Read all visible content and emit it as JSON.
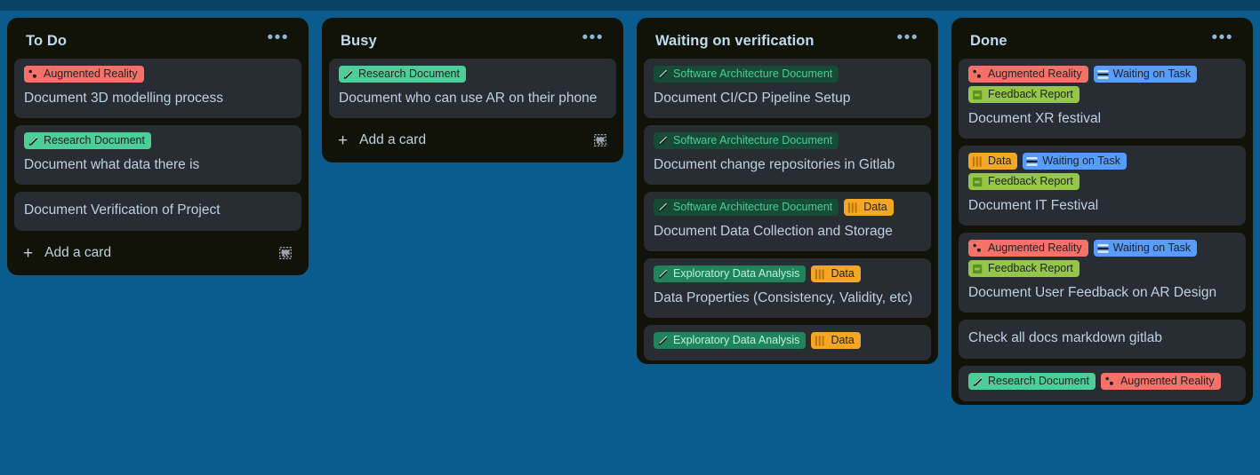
{
  "board": {
    "background_color": "#0a5c8f",
    "top_band_color": "#084264",
    "list_background": "#111208",
    "card_background": "#282c33"
  },
  "label_styles": {
    "augmented_reality": {
      "bg": "#f87168",
      "fg": "#1d2125",
      "icon": "particles-icon"
    },
    "research_document": {
      "bg": "#4bce97",
      "fg": "#1d2125",
      "icon": "pencil-icon"
    },
    "software_architecture_document": {
      "bg": "#164b35",
      "fg": "#4bce97",
      "icon": "pencil-icon"
    },
    "exploratory_data_analysis": {
      "bg": "#1f845a",
      "fg": "#baf3db",
      "icon": "pencil-icon"
    },
    "data": {
      "bg": "#f5a623",
      "fg": "#1d2125",
      "icon": "bars-icon"
    },
    "waiting_on_task": {
      "bg": "#579dff",
      "fg": "#1d2125",
      "icon": "stacked-lines-icon"
    },
    "feedback_report": {
      "bg": "#94c748",
      "fg": "#1d2125",
      "icon": "speech-bubble-icon"
    }
  },
  "add_card_label": "Add a card",
  "list_menu_glyph": "•••",
  "lists": [
    {
      "title": "To Do",
      "cards": [
        {
          "labels": [
            {
              "text": "Augmented Reality",
              "style": "augmented_reality"
            }
          ],
          "title": "Document 3D modelling process"
        },
        {
          "labels": [
            {
              "text": "Research Document",
              "style": "research_document"
            }
          ],
          "title": "Document what data there is"
        },
        {
          "labels": [],
          "title": "Document Verification of Project"
        }
      ],
      "show_add_card": true
    },
    {
      "title": "Busy",
      "cards": [
        {
          "labels": [
            {
              "text": "Research Document",
              "style": "research_document"
            }
          ],
          "title": "Document who can use AR on their phone"
        }
      ],
      "show_add_card": true
    },
    {
      "title": "Waiting on verification",
      "cards": [
        {
          "labels": [
            {
              "text": "Software Architecture Document",
              "style": "software_architecture_document"
            }
          ],
          "title": "Document CI/CD Pipeline Setup"
        },
        {
          "labels": [
            {
              "text": "Software Architecture Document",
              "style": "software_architecture_document"
            }
          ],
          "title": "Document change repositories in Gitlab"
        },
        {
          "labels": [
            {
              "text": "Software Architecture Document",
              "style": "software_architecture_document"
            },
            {
              "text": "Data",
              "style": "data"
            }
          ],
          "title": "Document Data Collection and Storage"
        },
        {
          "labels": [
            {
              "text": "Exploratory Data Analysis",
              "style": "exploratory_data_analysis"
            },
            {
              "text": "Data",
              "style": "data"
            }
          ],
          "title": "Data Properties (Consistency, Validity, etc)"
        },
        {
          "labels": [
            {
              "text": "Exploratory Data Analysis",
              "style": "exploratory_data_analysis"
            },
            {
              "text": "Data",
              "style": "data"
            }
          ],
          "title": ""
        }
      ],
      "show_add_card": false
    },
    {
      "title": "Done",
      "cards": [
        {
          "labels": [
            {
              "text": "Augmented Reality",
              "style": "augmented_reality"
            },
            {
              "text": "Waiting on Task",
              "style": "waiting_on_task"
            },
            {
              "text": "Feedback Report",
              "style": "feedback_report"
            }
          ],
          "title": "Document XR festival"
        },
        {
          "labels": [
            {
              "text": "Data",
              "style": "data"
            },
            {
              "text": "Waiting on Task",
              "style": "waiting_on_task"
            },
            {
              "text": "Feedback Report",
              "style": "feedback_report"
            }
          ],
          "title": "Document IT Festival"
        },
        {
          "labels": [
            {
              "text": "Augmented Reality",
              "style": "augmented_reality"
            },
            {
              "text": "Waiting on Task",
              "style": "waiting_on_task"
            },
            {
              "text": "Feedback Report",
              "style": "feedback_report"
            }
          ],
          "title": "Document User Feedback on AR Design"
        },
        {
          "labels": [],
          "title": "Check all docs markdown gitlab"
        },
        {
          "labels": [
            {
              "text": "Research Document",
              "style": "research_document"
            },
            {
              "text": "Augmented Reality",
              "style": "augmented_reality"
            }
          ],
          "title": ""
        }
      ],
      "show_add_card": false
    }
  ]
}
